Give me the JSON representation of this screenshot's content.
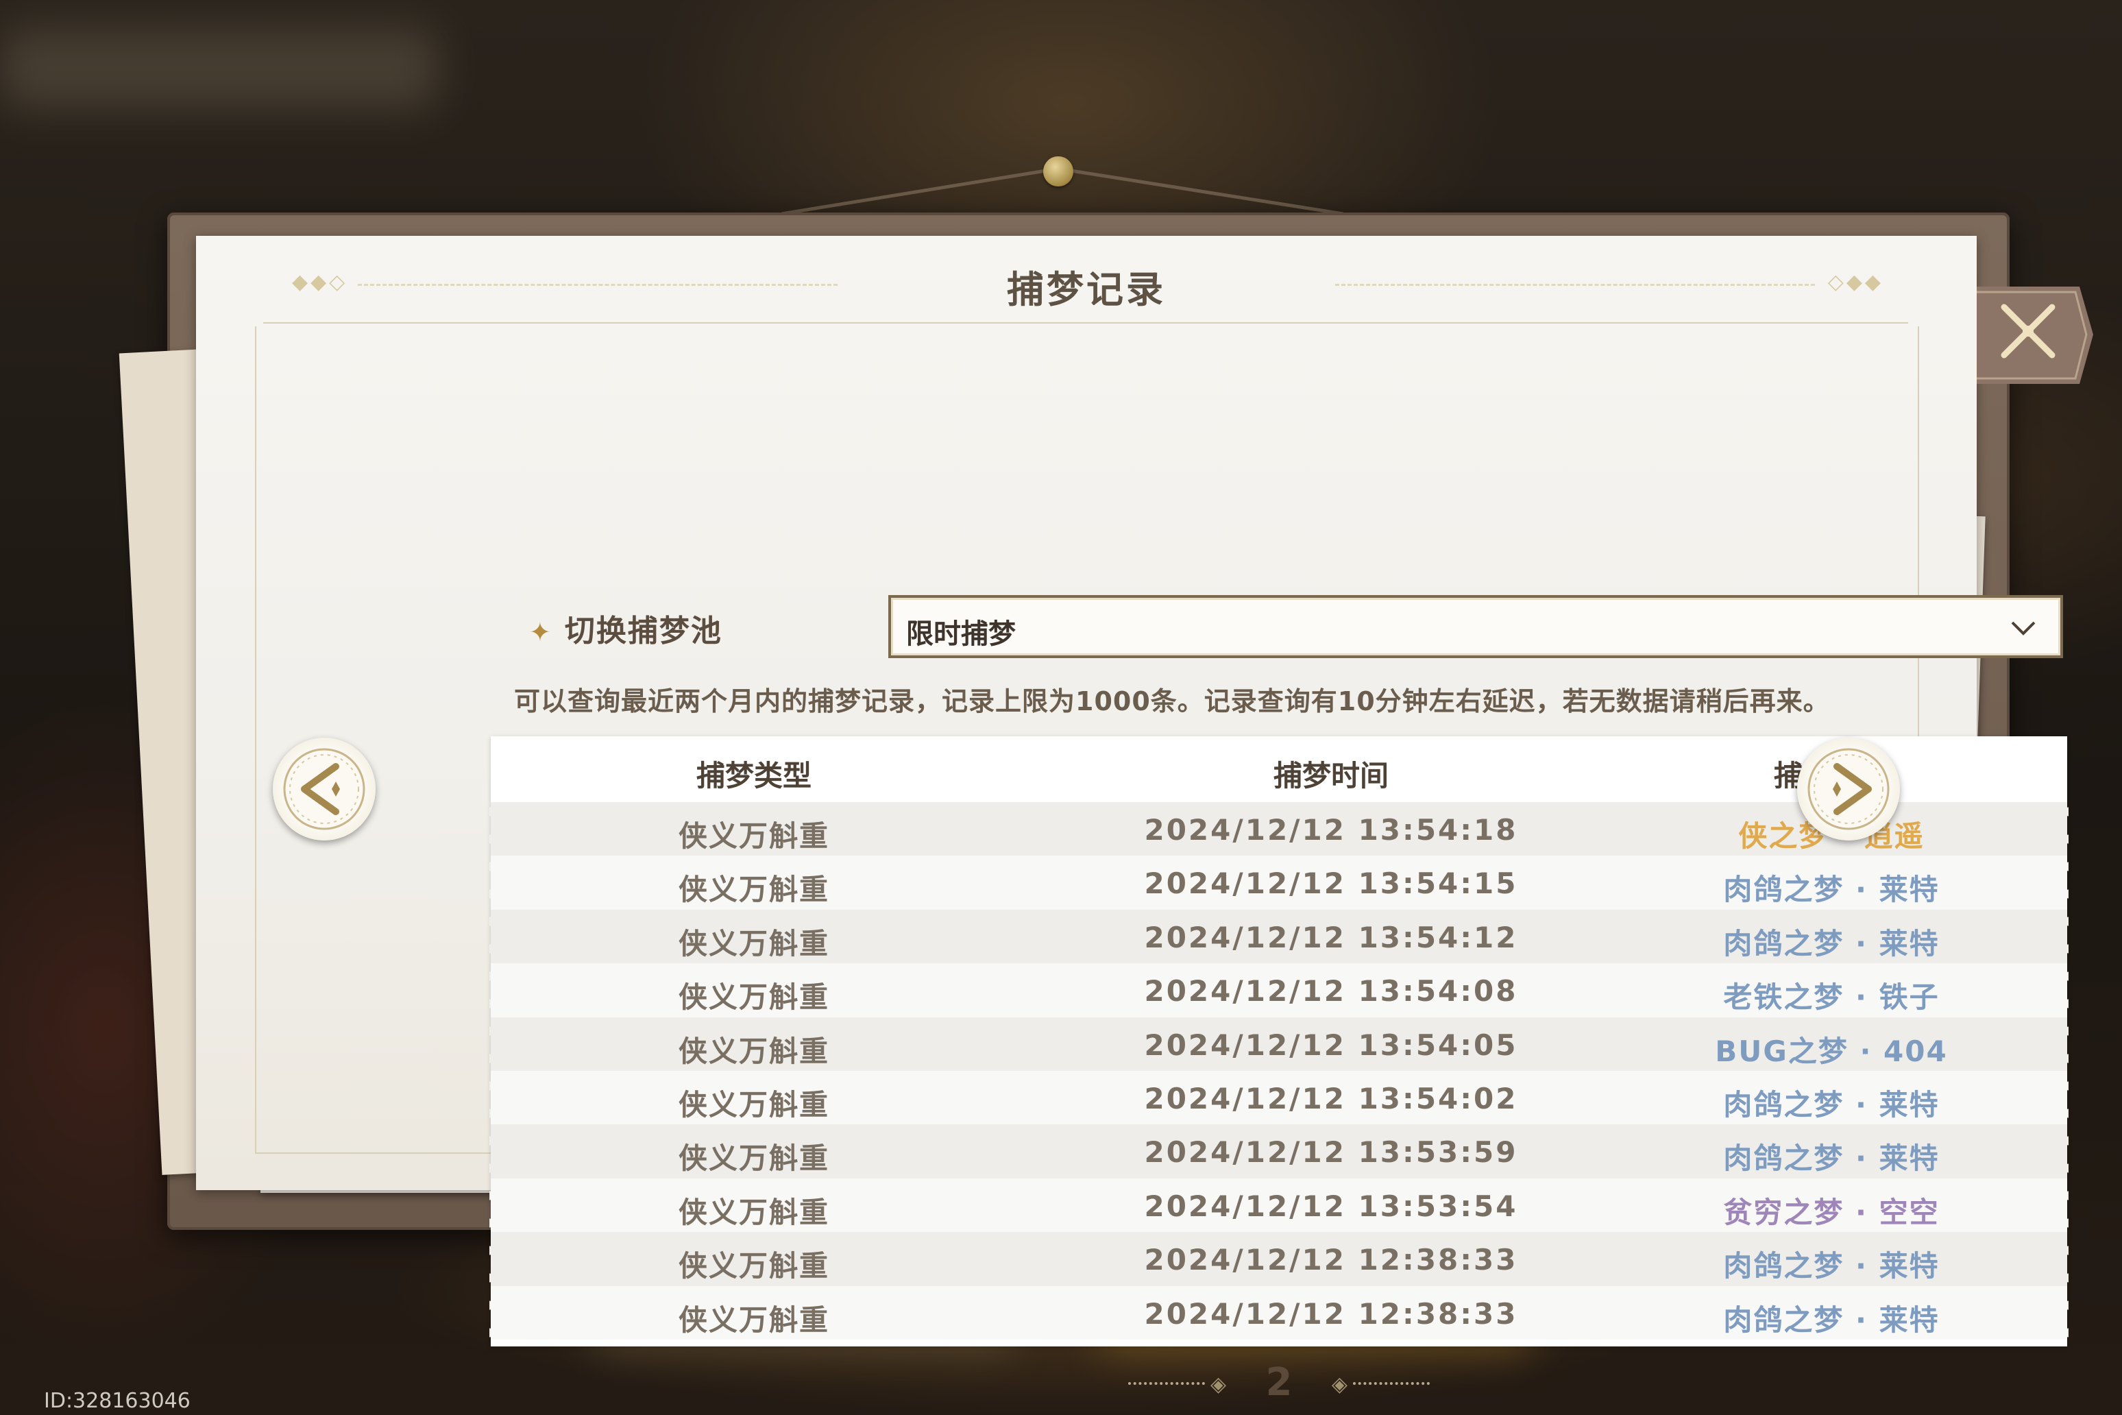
{
  "dialog": {
    "title": "捕梦记录",
    "title_deco_left": "◆◆◇",
    "title_deco_right": "◇◆◆"
  },
  "selector": {
    "label": "切换捕梦池",
    "star_icon": "four-point-star",
    "selected_value": "限时捕梦",
    "dropdown_icon": "chevron-down"
  },
  "info_text": "可以查询最近两个月内的捕梦记录，记录上限为1000条。记录查询有10分钟左右延迟，若无数据请稍后再来。",
  "table": {
    "headers": [
      "捕梦类型",
      "捕梦时间",
      "捕梦结果"
    ],
    "rows": [
      {
        "type": "侠义万斛重",
        "time": "2024/12/12 13:54:18",
        "result": "侠之梦 · 逍遥",
        "color": "#e0a94c"
      },
      {
        "type": "侠义万斛重",
        "time": "2024/12/12 13:54:15",
        "result": "肉鸽之梦 · 莱特",
        "color": "#7e9bc0"
      },
      {
        "type": "侠义万斛重",
        "time": "2024/12/12 13:54:12",
        "result": "肉鸽之梦 · 莱特",
        "color": "#7e9bc0"
      },
      {
        "type": "侠义万斛重",
        "time": "2024/12/12 13:54:08",
        "result": "老铁之梦 · 铁子",
        "color": "#7e9bc0"
      },
      {
        "type": "侠义万斛重",
        "time": "2024/12/12 13:54:05",
        "result": "BUG之梦 · 404",
        "color": "#7e9bc0"
      },
      {
        "type": "侠义万斛重",
        "time": "2024/12/12 13:54:02",
        "result": "肉鸽之梦 · 莱特",
        "color": "#7e9bc0"
      },
      {
        "type": "侠义万斛重",
        "time": "2024/12/12 13:53:59",
        "result": "肉鸽之梦 · 莱特",
        "color": "#7e9bc0"
      },
      {
        "type": "侠义万斛重",
        "time": "2024/12/12 13:53:54",
        "result": "贫穷之梦 · 空空",
        "color": "#9e86b8"
      },
      {
        "type": "侠义万斛重",
        "time": "2024/12/12 12:38:33",
        "result": "肉鸽之梦 · 莱特",
        "color": "#7e9bc0"
      },
      {
        "type": "侠义万斛重",
        "time": "2024/12/12 12:38:33",
        "result": "肉鸽之梦 · 莱特",
        "color": "#7e9bc0"
      }
    ]
  },
  "pager": {
    "page": "2",
    "deco_left": "◈",
    "deco_right": "◈"
  },
  "nav": {
    "prev_icon": "arrow-left-sparkle",
    "next_icon": "arrow-right-sparkle"
  },
  "close_icon": "close-x",
  "user_id": "ID:328163046",
  "colors": {
    "rarity_gold": "#e0a94c",
    "rarity_blue": "#7e9bc0",
    "rarity_purple": "#9e86b8",
    "frame_brown": "#7c6a4e"
  }
}
